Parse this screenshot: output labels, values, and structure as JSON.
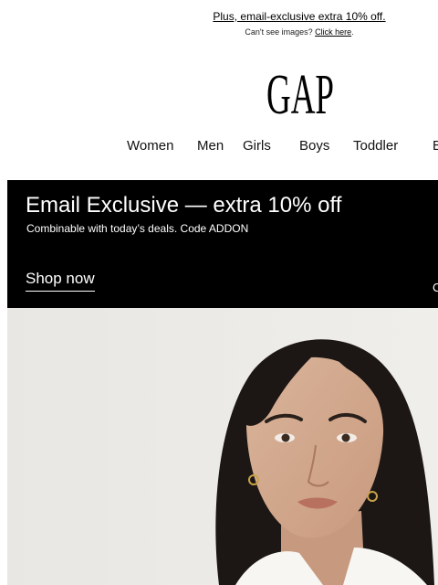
{
  "preheader": {
    "offer_link": "Plus, email-exclusive extra 10% off.",
    "cant_see_text": "Can't see images? ",
    "click_here": "Click here",
    "period": "."
  },
  "brand": {
    "logo_text": "GAP"
  },
  "nav": {
    "items": [
      {
        "label": "Women"
      },
      {
        "label": "Men"
      },
      {
        "label": "Girls"
      },
      {
        "label": "Boys"
      },
      {
        "label": "Toddler"
      },
      {
        "label": "B"
      }
    ]
  },
  "banner": {
    "title": "Email Exclusive — extra 10% off",
    "subtitle": "Combinable with today’s deals. Code ADDON",
    "cta": "Shop now",
    "edge_mark": "C"
  },
  "colors": {
    "banner_bg": "#000000",
    "banner_text": "#ffffff",
    "hero_bg": "#ebe9e5"
  }
}
